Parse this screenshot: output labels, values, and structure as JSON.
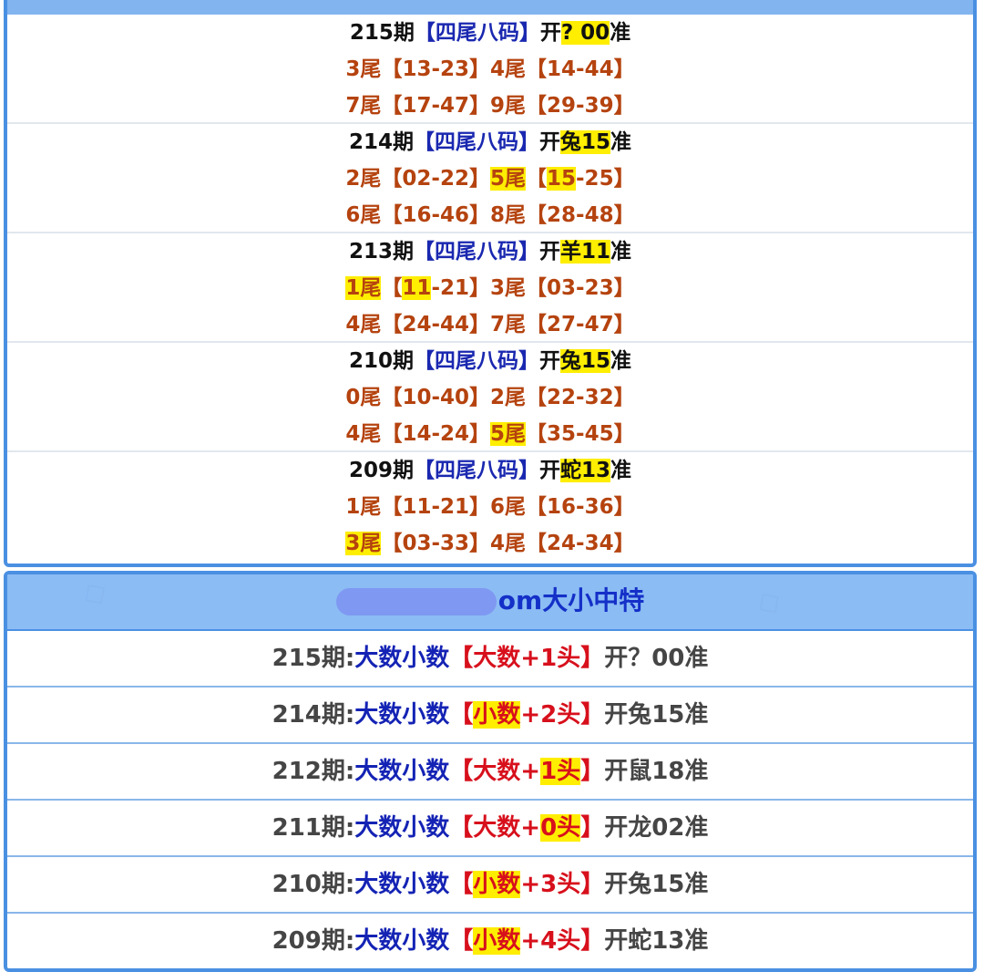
{
  "top_panel": {
    "groups": [
      {
        "issue": "215期",
        "tag": "【四尾八码】",
        "open_prefix": "开",
        "open_hl": "? 00",
        "open_suffix": "准",
        "line2": [
          {
            "text": "3尾",
            "hl": false
          },
          {
            "text": "【13-23】",
            "hl": false
          },
          {
            "text": "4尾",
            "hl": false
          },
          {
            "text": "【14-44】",
            "hl": false
          }
        ],
        "line3": [
          {
            "text": "7尾",
            "hl": false
          },
          {
            "text": "【17-47】",
            "hl": false
          },
          {
            "text": "9尾",
            "hl": false
          },
          {
            "text": "【29-39】",
            "hl": false
          }
        ]
      },
      {
        "issue": "214期",
        "tag": "【四尾八码】",
        "open_prefix": "开",
        "open_hl": "兔15",
        "open_suffix": "准",
        "line2": [
          {
            "text": "2尾",
            "hl": false
          },
          {
            "text": "【02-22】",
            "hl": false
          },
          {
            "text": "5尾",
            "hl": true
          },
          {
            "text": "【",
            "hl": false
          },
          {
            "text": "15",
            "hl": true
          },
          {
            "text": "-25】",
            "hl": false
          }
        ],
        "line3": [
          {
            "text": "6尾",
            "hl": false
          },
          {
            "text": "【16-46】",
            "hl": false
          },
          {
            "text": "8尾",
            "hl": false
          },
          {
            "text": "【28-48】",
            "hl": false
          }
        ]
      },
      {
        "issue": "213期",
        "tag": "【四尾八码】",
        "open_prefix": "开",
        "open_hl": "羊11",
        "open_suffix": "准",
        "line2": [
          {
            "text": "1尾",
            "hl": true
          },
          {
            "text": "【",
            "hl": false
          },
          {
            "text": "11",
            "hl": true
          },
          {
            "text": "-21】",
            "hl": false
          },
          {
            "text": "3尾",
            "hl": false
          },
          {
            "text": "【03-23】",
            "hl": false
          }
        ],
        "line3": [
          {
            "text": "4尾",
            "hl": false
          },
          {
            "text": "【24-44】",
            "hl": false
          },
          {
            "text": "7尾",
            "hl": false
          },
          {
            "text": "【27-47】",
            "hl": false
          }
        ]
      },
      {
        "issue": "210期",
        "tag": "【四尾八码】",
        "open_prefix": "开",
        "open_hl": "兔15",
        "open_suffix": "准",
        "line2": [
          {
            "text": "0尾",
            "hl": false
          },
          {
            "text": "【10-40】",
            "hl": false
          },
          {
            "text": "2尾",
            "hl": false
          },
          {
            "text": "【22-32】",
            "hl": false
          }
        ],
        "line3": [
          {
            "text": "4尾",
            "hl": false
          },
          {
            "text": "【14-24】",
            "hl": false
          },
          {
            "text": "5尾",
            "hl": true
          },
          {
            "text": "【35-45】",
            "hl": false
          }
        ]
      },
      {
        "issue": "209期",
        "tag": "【四尾八码】",
        "open_prefix": "开",
        "open_hl": "蛇13",
        "open_suffix": "准",
        "line2": [
          {
            "text": "1尾",
            "hl": false
          },
          {
            "text": "【11-21】",
            "hl": false
          },
          {
            "text": "6尾",
            "hl": false
          },
          {
            "text": "【16-36】",
            "hl": false
          }
        ],
        "line3": [
          {
            "text": "3尾",
            "hl": true
          },
          {
            "text": "【03-33】",
            "hl": false
          },
          {
            "text": "4尾",
            "hl": false
          },
          {
            "text": "【24-34】",
            "hl": false
          }
        ]
      }
    ]
  },
  "bottom_panel": {
    "header_suffix": "om大小中特",
    "rows": [
      {
        "issue": "215期:",
        "label": "大数小数",
        "parts": [
          {
            "text": "【大数+1头】",
            "hl": false
          }
        ],
        "open": "开？00准"
      },
      {
        "issue": "214期:",
        "label": "大数小数",
        "parts": [
          {
            "text": "【",
            "hl": false
          },
          {
            "text": "小数",
            "hl": true
          },
          {
            "text": "+2头】",
            "hl": false
          }
        ],
        "open": "开兔15准"
      },
      {
        "issue": "212期:",
        "label": "大数小数",
        "parts": [
          {
            "text": "【大数+",
            "hl": false
          },
          {
            "text": "1头",
            "hl": true
          },
          {
            "text": "】",
            "hl": false
          }
        ],
        "open": "开鼠18准"
      },
      {
        "issue": "211期:",
        "label": "大数小数",
        "parts": [
          {
            "text": "【大数+",
            "hl": false
          },
          {
            "text": "0头",
            "hl": true
          },
          {
            "text": "】",
            "hl": false
          }
        ],
        "open": "开龙02准"
      },
      {
        "issue": "210期:",
        "label": "大数小数",
        "parts": [
          {
            "text": "【",
            "hl": false
          },
          {
            "text": "小数",
            "hl": true
          },
          {
            "text": "+3头】",
            "hl": false
          }
        ],
        "open": "开兔15准"
      },
      {
        "issue": "209期:",
        "label": "大数小数",
        "parts": [
          {
            "text": "【",
            "hl": false
          },
          {
            "text": "小数",
            "hl": true
          },
          {
            "text": "+4头】",
            "hl": false
          }
        ],
        "open": "开蛇13准"
      }
    ]
  }
}
